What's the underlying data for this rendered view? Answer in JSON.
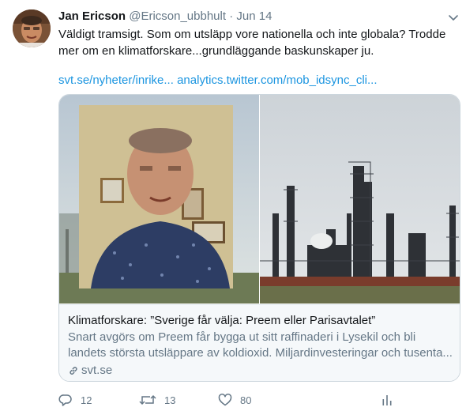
{
  "tweet": {
    "author_name": "Jan Ericson",
    "handle": "@Ericson_ubbhult",
    "separator": "·",
    "date": "Jun 14",
    "text_line1": "Väldigt tramsigt. Som om utsläpp vore nationella och inte globala? Trodde",
    "text_line2": "mer om en klimatforskare...grundläggande baskunskaper ju.",
    "link1": "svt.se/nyheter/inrike...",
    "link2": "analytics.twitter.com/mob_idsync_cli..."
  },
  "card": {
    "title": "Klimatforskare: ”Sverige får välja: Preem eller Parisavtalet”",
    "desc_line1": "Snart avgörs om Preem får bygga ut sitt raffinaderi i Lysekil och bli",
    "desc_line2": "landets största utsläppare av koldioxid. Miljardinvesteringar och tusenta...",
    "domain": "svt.se"
  },
  "actions": {
    "reply_count": "12",
    "retweet_count": "13",
    "like_count": "80"
  },
  "icons": [
    "avatar",
    "chevron-down-icon",
    "link-icon",
    "reply-icon",
    "retweet-icon",
    "like-icon",
    "analytics-icon"
  ],
  "colors": {
    "link": "#1b95e0",
    "muted": "#657786",
    "border": "#ccd6dd"
  }
}
